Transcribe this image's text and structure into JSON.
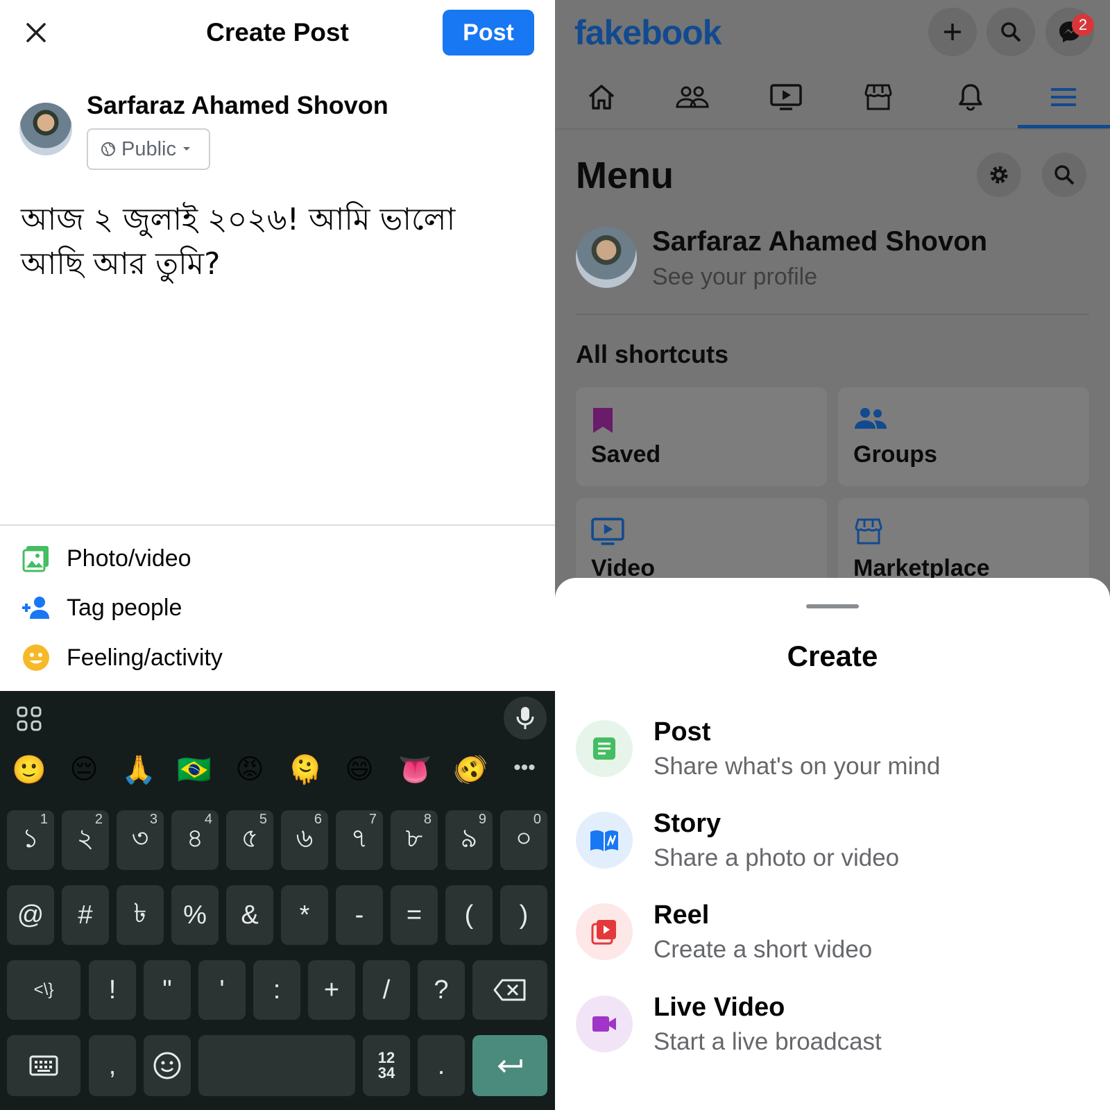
{
  "create_post": {
    "title": "Create Post",
    "post_button": "Post",
    "user_name": "Sarfaraz Ahamed Shovon",
    "audience": "Public",
    "text_line1": "আজ ২ জুলাই ২০২৬! আমি ভালো",
    "text_line2": "আছি আর তুমি?",
    "actions": [
      {
        "label": "Photo/video",
        "icon": "photo-icon",
        "color": "#45bd62"
      },
      {
        "label": "Tag people",
        "icon": "tag-people-icon",
        "color": "#1877f2"
      },
      {
        "label": "Feeling/activity",
        "icon": "feeling-icon",
        "color": "#f7b928"
      }
    ]
  },
  "keyboard": {
    "emoji_row": [
      "🙂",
      "😔",
      "🙏",
      "🇧🇷",
      "😡",
      "🫠",
      "😄",
      "👅",
      "🫨"
    ],
    "more": "•••",
    "row1": [
      {
        "key": "১",
        "hint": "1"
      },
      {
        "key": "২",
        "hint": "2"
      },
      {
        "key": "৩",
        "hint": "3"
      },
      {
        "key": "৪",
        "hint": "4"
      },
      {
        "key": "৫",
        "hint": "5"
      },
      {
        "key": "৬",
        "hint": "6"
      },
      {
        "key": "৭",
        "hint": "7"
      },
      {
        "key": "৮",
        "hint": "8"
      },
      {
        "key": "৯",
        "hint": "9"
      },
      {
        "key": "০",
        "hint": "0"
      }
    ],
    "row2": [
      "@",
      "#",
      "৳",
      "%",
      "&",
      "*",
      "-",
      "=",
      "(",
      ")"
    ],
    "row3": [
      "<\\}",
      "!",
      "\"",
      "'",
      ":",
      "+",
      "/",
      "?"
    ],
    "row4": {
      "comma": ",",
      "numbers_top": "12",
      "numbers_bottom": "34",
      "period": "."
    },
    "enter_color": "#4b8b7d"
  },
  "menu": {
    "logo": "fakebook",
    "messenger_badge": "2",
    "title": "Menu",
    "profile_name": "Sarfaraz Ahamed Shovon",
    "profile_sub": "See your profile",
    "shortcuts_heading": "All shortcuts",
    "shortcuts": [
      {
        "label": "Saved",
        "icon": "bookmark-icon",
        "color": "#6a1b6a"
      },
      {
        "label": "Groups",
        "icon": "groups-icon",
        "color": "#124a90"
      },
      {
        "label": "Video",
        "icon": "video-icon",
        "color": "#124a90"
      },
      {
        "label": "Marketplace",
        "icon": "marketplace-icon",
        "color": "#124a90"
      }
    ],
    "brand_color": "#124a90"
  },
  "sheet": {
    "title": "Create",
    "options": [
      {
        "title": "Post",
        "subtitle": "Share what's on your mind",
        "icon": "post-icon",
        "color": "#45bd62",
        "bg": "#e6f4ea"
      },
      {
        "title": "Story",
        "subtitle": "Share a photo or video",
        "icon": "story-icon",
        "color": "#1877f2",
        "bg": "#e3eefc"
      },
      {
        "title": "Reel",
        "subtitle": "Create a short video",
        "icon": "reel-icon",
        "color": "#e4393c",
        "bg": "#fde7e7"
      },
      {
        "title": "Live Video",
        "subtitle": "Start a live broadcast",
        "icon": "live-video-icon",
        "color": "#a035c7",
        "bg": "#f2e4f7"
      }
    ]
  }
}
